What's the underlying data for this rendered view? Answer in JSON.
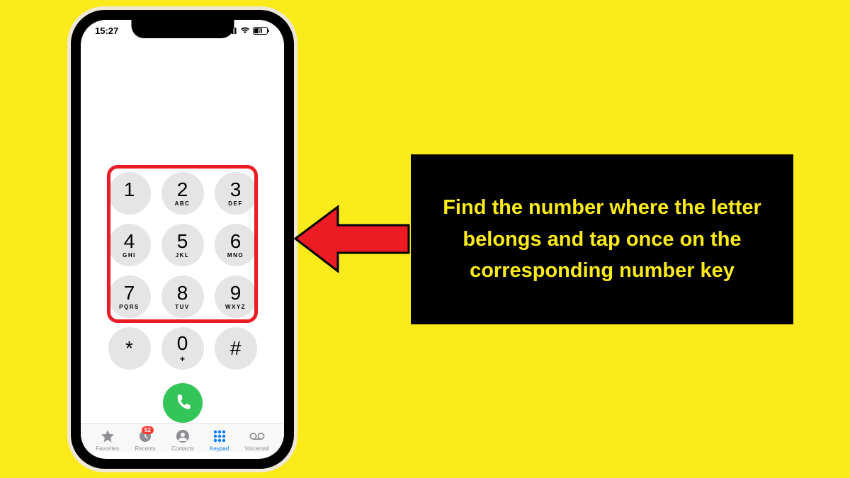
{
  "status": {
    "time": "15:27",
    "battery": "61"
  },
  "keypad": {
    "keys": [
      {
        "digit": "1",
        "letters": ""
      },
      {
        "digit": "2",
        "letters": "ABC"
      },
      {
        "digit": "3",
        "letters": "DEF"
      },
      {
        "digit": "4",
        "letters": "GHI"
      },
      {
        "digit": "5",
        "letters": "JKL"
      },
      {
        "digit": "6",
        "letters": "MNO"
      },
      {
        "digit": "7",
        "letters": "PQRS"
      },
      {
        "digit": "8",
        "letters": "TUV"
      },
      {
        "digit": "9",
        "letters": "WXYZ"
      },
      {
        "digit": "*",
        "letters": ""
      },
      {
        "digit": "0",
        "letters": "+"
      },
      {
        "digit": "#",
        "letters": ""
      }
    ]
  },
  "tabs": {
    "favorites": "Favorites",
    "recents": "Recents",
    "recents_badge": "52",
    "contacts": "Contacts",
    "keypad": "Keypad",
    "voicemail": "Voicemail"
  },
  "callout": {
    "text": "Find the number where the letter belongs and tap once on the corresponding number key"
  },
  "colors": {
    "background": "#fbeb1a",
    "highlight": "#ec1c24",
    "call": "#33c558",
    "active": "#007aff"
  }
}
